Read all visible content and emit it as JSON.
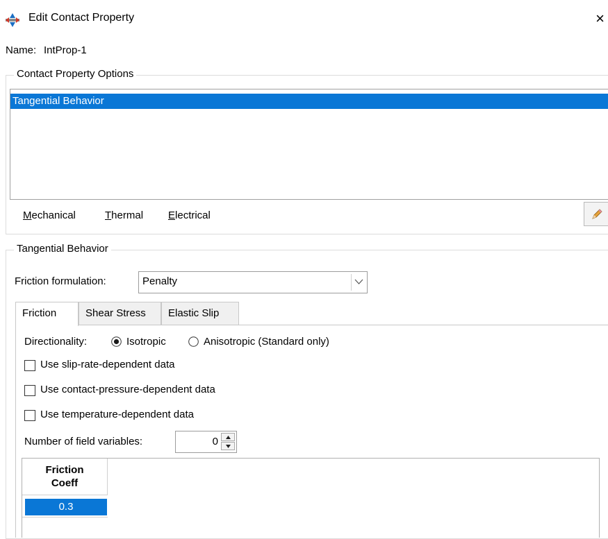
{
  "window": {
    "title": "Edit Contact Property",
    "close_glyph": "×",
    "app_icon": "abaqus-compass-icon"
  },
  "name": {
    "label": "Name:",
    "value": "IntProp-1"
  },
  "contact_property_options": {
    "title": "Contact Property Options",
    "items": [
      "Tangential Behavior"
    ],
    "selected_index": 0,
    "menus": {
      "mechanical": {
        "first": "M",
        "rest": "echanical"
      },
      "thermal": {
        "first": "T",
        "rest": "hermal"
      },
      "electrical": {
        "first": "E",
        "rest": "lectrical"
      }
    },
    "edit_icon": "pencil-eraser-icon"
  },
  "tangential_behavior": {
    "title": "Tangential Behavior",
    "friction_formulation_label": "Friction formulation:",
    "friction_formulation_value": "Penalty",
    "tabs": [
      "Friction",
      "Shear Stress",
      "Elastic Slip"
    ],
    "active_tab": 0,
    "directionality_label": "Directionality:",
    "directionality_options": [
      "Isotropic",
      "Anisotropic (Standard only)"
    ],
    "directionality_selected": 0,
    "checkboxes": [
      {
        "label": "Use slip-rate-dependent data",
        "checked": false
      },
      {
        "label": "Use contact-pressure-dependent data",
        "checked": false
      },
      {
        "label": "Use temperature-dependent data",
        "checked": false
      }
    ],
    "field_variables_label": "Number of field variables:",
    "field_variables_value": "0",
    "table": {
      "header_line1": "Friction",
      "header_line2": "Coeff",
      "rows": [
        "0.3"
      ]
    }
  },
  "colors": {
    "selection": "#0a77d6",
    "border": "#dcdcdc"
  }
}
